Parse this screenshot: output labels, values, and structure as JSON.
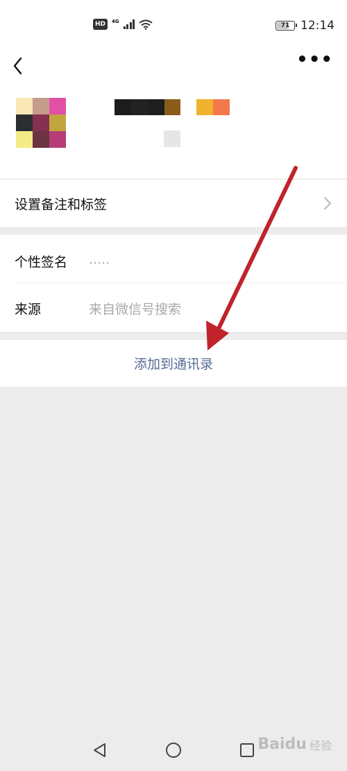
{
  "status_bar": {
    "hd_badge": "HD",
    "network_label": "4G",
    "battery_level": "71",
    "battery_fraction": 0.71,
    "time": "12:14"
  },
  "header": {
    "back_icon": "chevron-left-icon",
    "more_label": "•••",
    "avatar_colors": [
      "#fbe6b5",
      "#c59c8a",
      "#e24fa7",
      "#2b2d30",
      "#84304e",
      "#c2a53d",
      "#f3ec86",
      "#6b3440",
      "#b73d78"
    ],
    "name_blur_colors": [
      "#1c1c1c",
      "#222222",
      "#1e1e1e",
      "#8a5c1a",
      "#ffffff",
      "#f0b22c",
      "#f3784e"
    ]
  },
  "rows": {
    "remark": {
      "label": "设置备注和标签"
    },
    "signature": {
      "label": "个性签名",
      "value": "....."
    },
    "source": {
      "label": "来源",
      "value": "来自微信号搜索"
    }
  },
  "action": {
    "add_contact": "添加到通讯录"
  },
  "nav": {
    "back_icon": "triangle-back-icon",
    "home_icon": "circle-home-icon",
    "recents_icon": "square-recents-icon"
  },
  "watermark": {
    "text": "Baidu",
    "sub": "经验"
  },
  "colors": {
    "link": "#576b95",
    "arrow": "#c0232b",
    "background": "#ececec"
  }
}
